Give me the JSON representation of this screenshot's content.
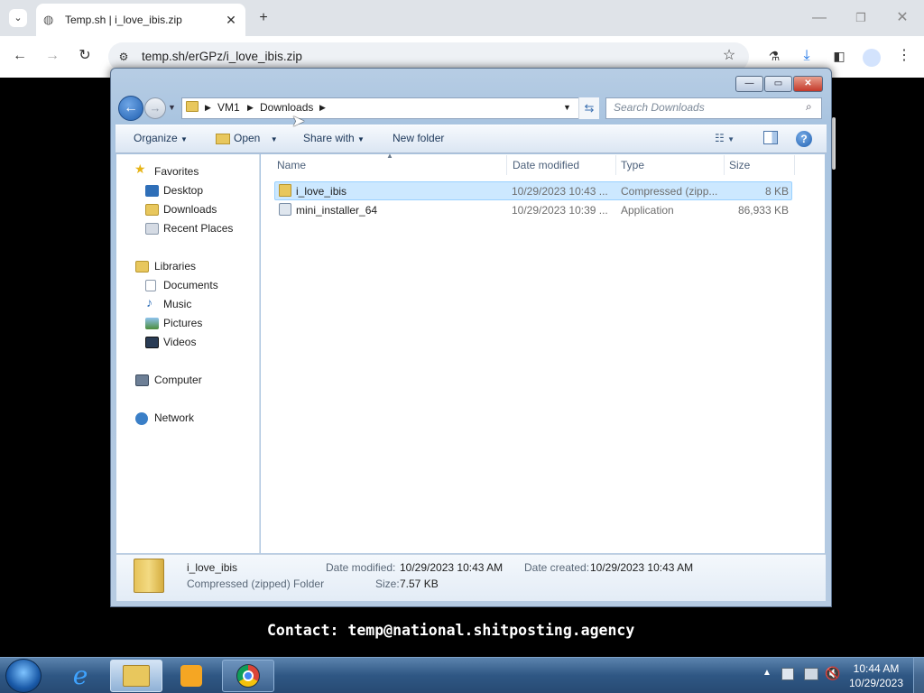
{
  "browser": {
    "tab_title": "Temp.sh | i_love_ibis.zip",
    "url": "temp.sh/erGPz/i_love_ibis.zip",
    "page_text": "Contact: temp@national.shitposting.agency"
  },
  "explorer": {
    "breadcrumb": [
      "VM1",
      "Downloads"
    ],
    "search_placeholder": "Search Downloads",
    "commands": {
      "organize": "Organize",
      "open": "Open",
      "share_with": "Share with",
      "new_folder": "New folder"
    },
    "nav": {
      "favorites": "Favorites",
      "desktop": "Desktop",
      "downloads": "Downloads",
      "recent_places": "Recent Places",
      "libraries": "Libraries",
      "documents": "Documents",
      "music": "Music",
      "pictures": "Pictures",
      "videos": "Videos",
      "computer": "Computer",
      "network": "Network"
    },
    "columns": {
      "name": "Name",
      "date_modified": "Date modified",
      "type": "Type",
      "size": "Size"
    },
    "files": [
      {
        "name": "i_love_ibis",
        "date": "10/29/2023 10:43 ...",
        "type": "Compressed (zipp...",
        "size": "8 KB"
      },
      {
        "name": "mini_installer_64",
        "date": "10/29/2023 10:39 ...",
        "type": "Application",
        "size": "86,933 KB"
      }
    ],
    "details": {
      "name": "i_love_ibis",
      "kind": "Compressed (zipped) Folder",
      "date_modified_label": "Date modified:",
      "date_modified": "10/29/2023 10:43 AM",
      "size_label": "Size:",
      "size": "7.57 KB",
      "date_created_label": "Date created:",
      "date_created": "10/29/2023 10:43 AM"
    }
  },
  "taskbar": {
    "time": "10:44 AM",
    "date": "10/29/2023"
  },
  "colors": {
    "selection": "#cce8ff",
    "chrome_bg": "#dfe3e8",
    "explorer_frame": "#a9c4e0"
  }
}
